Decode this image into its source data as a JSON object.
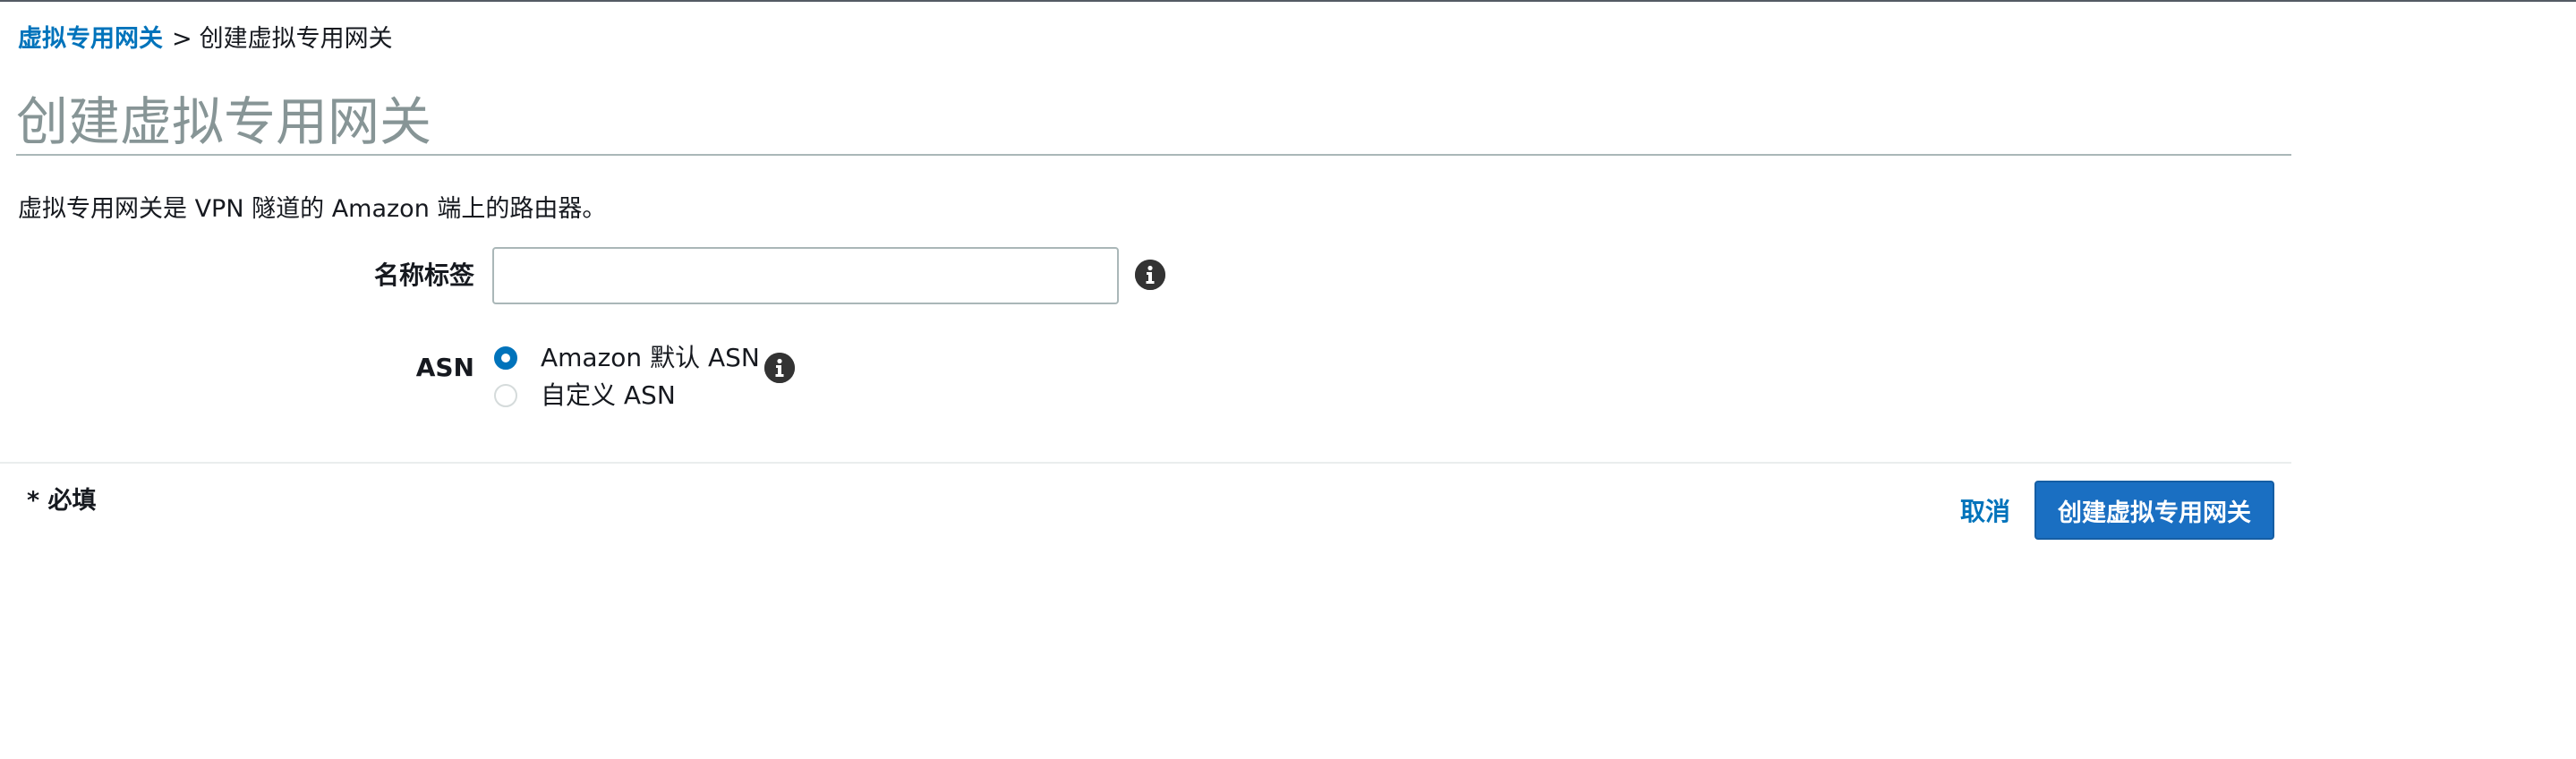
{
  "breadcrumb": {
    "parent": "虚拟专用网关",
    "separator": ">",
    "current": "创建虚拟专用网关"
  },
  "page_title": "创建虚拟专用网关",
  "description": "虚拟专用网关是 VPN 隧道的 Amazon 端上的路由器。",
  "form": {
    "name_tag": {
      "label": "名称标签",
      "value": "",
      "placeholder": ""
    },
    "asn": {
      "label": "ASN",
      "options": [
        {
          "label": "Amazon 默认 ASN",
          "selected": true
        },
        {
          "label": "自定义 ASN",
          "selected": false
        }
      ]
    }
  },
  "footer": {
    "required_note": "* 必填",
    "cancel_label": "取消",
    "create_label": "创建虚拟专用网关"
  },
  "colors": {
    "link": "#0073bb",
    "primary_button": "#1a6fc2",
    "title_gray": "#879596",
    "info_icon": "#333333"
  },
  "icons": [
    "info-icon",
    "radio-checked",
    "radio-unchecked"
  ]
}
